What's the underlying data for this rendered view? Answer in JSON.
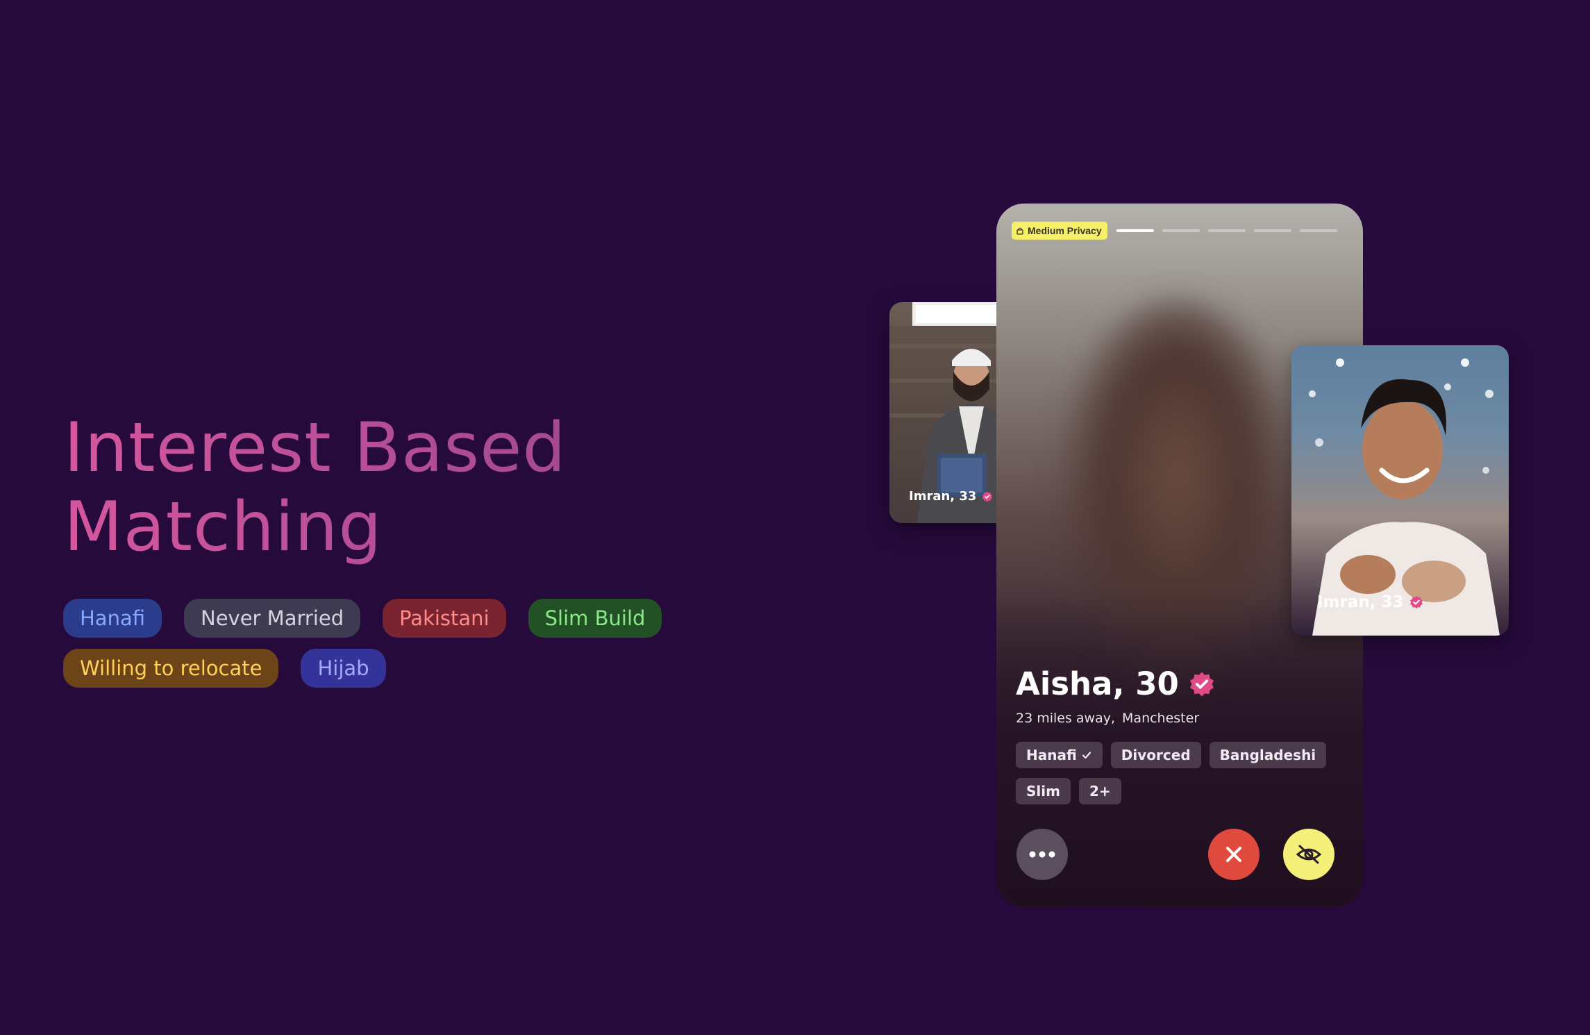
{
  "headline": {
    "line1": "Interest Based",
    "line2": "Matching"
  },
  "interest_chips": {
    "row1": [
      {
        "label": "Hanafi",
        "bg": "#2b3c8c",
        "fg": "#86a8ff"
      },
      {
        "label": "Never Married",
        "bg": "#3d3a52",
        "fg": "#d6d3de"
      },
      {
        "label": "Pakistani",
        "bg": "#7b2431",
        "fg": "#ff8c87"
      },
      {
        "label": "Slim Build",
        "bg": "#225126",
        "fg": "#8de88a"
      }
    ],
    "row2": [
      {
        "label": "Willing to relocate",
        "bg": "#6d4318",
        "fg": "#ffd15a"
      },
      {
        "label": "Hijab",
        "bg": "#34339a",
        "fg": "#a7a8ff"
      }
    ]
  },
  "profile": {
    "privacy_badge": "Medium Privacy",
    "photo_count": 5,
    "active_photo": 1,
    "name_age": "Aisha, 30",
    "distance": "23 miles away,",
    "city": "Manchester",
    "tags_row1": [
      "Hanafi",
      "Divorced",
      "Bangladeshi"
    ],
    "tags_row2": [
      "Slim",
      "2+"
    ],
    "verified_color": "#e04a86"
  },
  "side_cards": {
    "left": {
      "label": "Imran, 33"
    },
    "right": {
      "label": "Imran, 33"
    }
  },
  "actions": {
    "more": "more-icon",
    "pass": "close-icon",
    "hide": "eye-off-icon"
  }
}
